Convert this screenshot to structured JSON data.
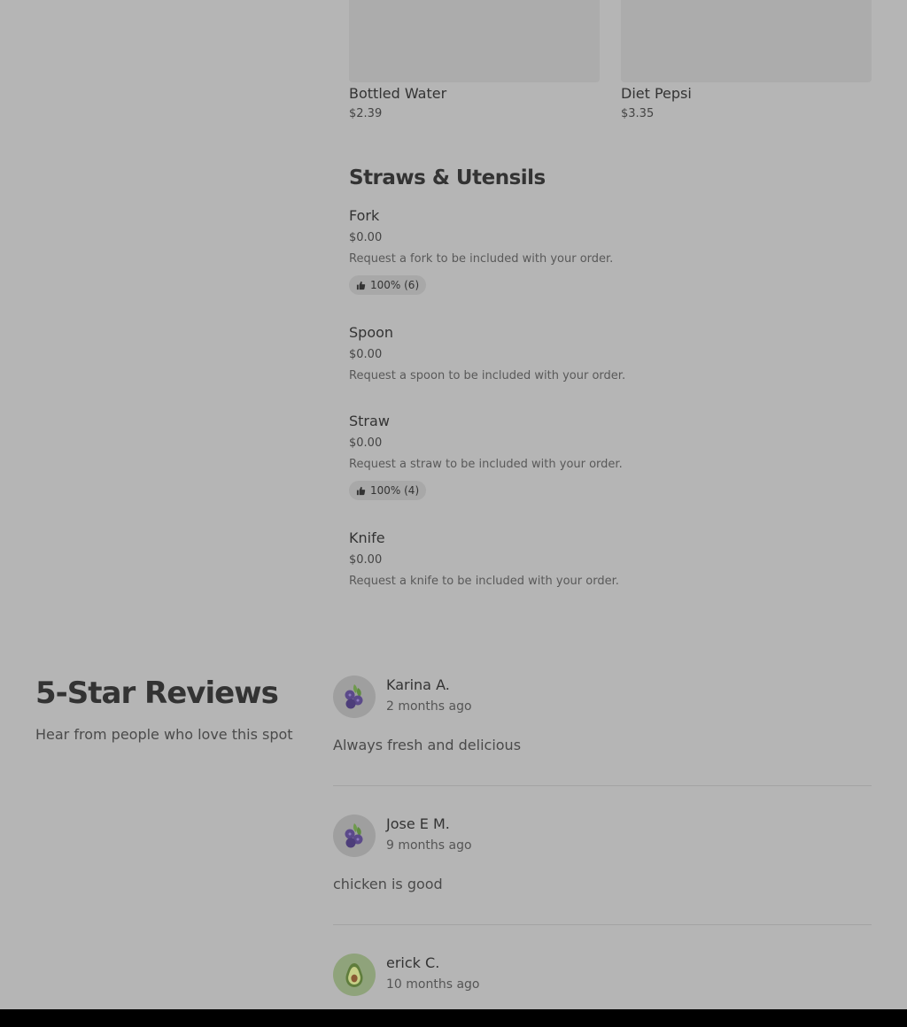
{
  "drinks": [
    {
      "name": "Bottled Water",
      "price": "$2.39"
    },
    {
      "name": "Diet Pepsi",
      "price": "$3.35"
    }
  ],
  "straws_section": {
    "title": "Straws & Utensils",
    "items": [
      {
        "name": "Fork",
        "price": "$0.00",
        "description": "Request a fork to be included with your order.",
        "rating": "100% (6)"
      },
      {
        "name": "Spoon",
        "price": "$0.00",
        "description": "Request a spoon to be included with your order."
      },
      {
        "name": "Straw",
        "price": "$0.00",
        "description": "Request a straw to be included with your order.",
        "rating": "100% (4)"
      },
      {
        "name": "Knife",
        "price": "$0.00",
        "description": "Request a knife to be included with your order."
      }
    ]
  },
  "reviews": {
    "title": "5-Star Reviews",
    "subtitle": "Hear from people who love this spot",
    "items": [
      {
        "name": "Karina A.",
        "time": "2 months ago",
        "text": "Always fresh and delicious",
        "avatar_icon": "blueberry-icon"
      },
      {
        "name": "Jose E M.",
        "time": "9 months ago",
        "text": "chicken is good",
        "avatar_icon": "blueberry-icon"
      },
      {
        "name": "erick C.",
        "time": "10 months ago",
        "avatar_icon": "avocado-icon"
      }
    ]
  },
  "colors": {
    "overlay_background": "#b5b5b5",
    "badge_background": "#a8a8a8"
  }
}
